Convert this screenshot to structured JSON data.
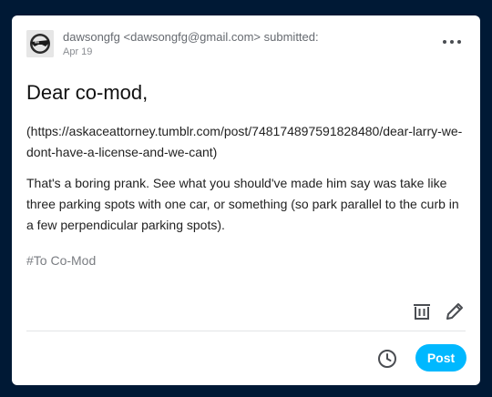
{
  "submission": {
    "submitter_name": "dawsongfg",
    "submitter_email": "<dawsongfg@gmail.com>",
    "submitted_label": "submitted:",
    "date": "Apr 19",
    "avatar_icon": "sunglasses-avatar-icon",
    "more_icon": "ellipsis-icon"
  },
  "post": {
    "title": "Dear co-mod,",
    "link": "(https://askaceattorney.tumblr.com/post/748174897591828480/dear-larry-we-dont-have-a-license-and-we-cant)",
    "paragraph": "That's a boring prank. See what you should've made him say was take like three parking spots with one car, or something (so park parallel to the curb in a few perpendicular parking spots).",
    "tag": "#To Co-Mod"
  },
  "actions": {
    "delete_icon": "trash-icon",
    "edit_icon": "pencil-icon",
    "schedule_icon": "clock-icon",
    "post_label": "Post"
  },
  "colors": {
    "background": "#001935",
    "card": "#ffffff",
    "accent": "#00b8ff",
    "muted_text": "#666a70"
  }
}
